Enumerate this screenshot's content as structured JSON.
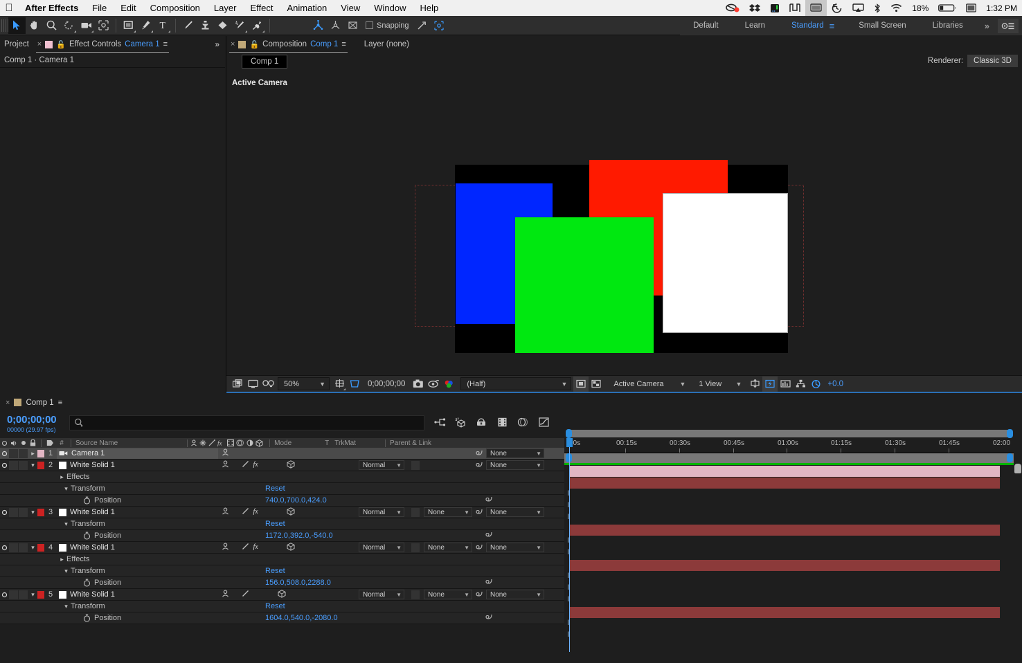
{
  "menubar": {
    "apple": "apple-logo",
    "app": "After Effects",
    "items": [
      "File",
      "Edit",
      "Composition",
      "Layer",
      "Effect",
      "Animation",
      "View",
      "Window",
      "Help"
    ],
    "status": {
      "battery_percent": "18%",
      "time": "1:32 PM",
      "icons": [
        "screen-record-icon",
        "dropbox-icon",
        "drive-icon",
        "sidecar-icon",
        "display-icon",
        "time-machine-icon",
        "airplay-icon",
        "bluetooth-icon",
        "wifi-icon",
        "battery-icon",
        "input-source-icon"
      ]
    }
  },
  "toolbar": {
    "tools": [
      {
        "name": "selection-tool",
        "glyph": "➤",
        "selected": true
      },
      {
        "name": "hand-tool",
        "glyph": "✋",
        "selected": false
      },
      {
        "name": "zoom-tool",
        "glyph": "🔍",
        "selected": false
      },
      {
        "name": "rotation-tool",
        "glyph": "↺",
        "selected": false
      },
      {
        "name": "camera-tool",
        "glyph": "🎥",
        "selected": false
      },
      {
        "name": "pan-behind-tool",
        "glyph": "⬚",
        "selected": false
      },
      {
        "name": "shape-tool",
        "glyph": "■",
        "selected": false
      },
      {
        "name": "pen-tool",
        "glyph": "✒",
        "selected": false
      },
      {
        "name": "text-tool",
        "glyph": "T",
        "selected": false
      },
      {
        "name": "brush-tool",
        "glyph": "╱",
        "selected": false
      },
      {
        "name": "clone-stamp-tool",
        "glyph": "⚒",
        "selected": false
      },
      {
        "name": "eraser-tool",
        "glyph": "◆",
        "selected": false
      },
      {
        "name": "roto-brush-tool",
        "glyph": "✦",
        "selected": false
      },
      {
        "name": "puppet-pin-tool",
        "glyph": "📌",
        "selected": false
      }
    ],
    "axis_modes": [
      {
        "name": "local-axis-mode",
        "selected": true
      },
      {
        "name": "world-axis-mode",
        "selected": false
      },
      {
        "name": "view-axis-mode",
        "selected": false
      }
    ],
    "snapping_label": "Snapping",
    "snapping_checked": false
  },
  "workspaces": {
    "items": [
      "Default",
      "Learn",
      "Standard",
      "Small Screen",
      "Libraries"
    ],
    "selected": "Standard",
    "overflow": "»",
    "gear_name": "workspace-settings-icon"
  },
  "left_panel": {
    "tabs": [
      {
        "label": "Project",
        "active": false,
        "closable": false
      },
      {
        "label": "Effect Controls",
        "target": "Camera 1",
        "active": true,
        "closable": true
      }
    ],
    "subheader": "Comp 1 · Camera 1"
  },
  "comp_panel": {
    "tabs": [
      {
        "label": "Composition",
        "target": "Comp 1",
        "active": true,
        "closable": true
      },
      {
        "label": "Layer (none)",
        "active": false,
        "closable": false
      }
    ],
    "comp_chip": "Comp 1",
    "renderer_label": "Renderer:",
    "renderer_value": "Classic 3D",
    "view_label": "Active Camera",
    "bottom_bar": {
      "magnification": "50%",
      "timecode": "0;00;00;00",
      "resolution": "(Half)",
      "view_select": "Active Camera",
      "view_layout": "1 View",
      "exposure": "+0.0",
      "icons": [
        "always-preview-icon",
        "main-viewer-icon",
        "3d-glasses-icon",
        "region-of-interest-icon",
        "transparency-grid-icon",
        "take-snapshot-icon",
        "show-snapshot-icon",
        "channel-icon",
        "mask-visibility-icon",
        "toggle-guides-icon",
        "3d-view-popup-icon",
        "pixel-aspect-icon",
        "fast-previews-icon",
        "timeline-icon",
        "comp-flowchart-icon",
        "exposure-icon"
      ]
    }
  },
  "timeline": {
    "tab_label": "Comp 1",
    "current_time": "0;00;00;00",
    "frame_info": "00000 (29.97 fps)",
    "search_placeholder": "",
    "columns": [
      "Source Name",
      "Mode",
      "T",
      "TrkMat",
      "Parent & Link"
    ],
    "header_icons": [
      "video-toggle-icon",
      "audio-toggle-icon",
      "solo-icon",
      "lock-icon",
      "label-icon",
      "index-icon"
    ],
    "switch_icons": [
      "shy-icon",
      "collapse-icon",
      "quality-icon",
      "effects-icon",
      "frame-blend-icon",
      "motion-blur-icon",
      "adjustment-icon",
      "3d-layer-icon"
    ],
    "panel_icons": [
      "composition-mini-flowchart-icon",
      "draft-3d-icon",
      "hide-shy-layers-icon",
      "enable-frame-blending-icon",
      "enable-motion-blur-icon",
      "graph-editor-icon"
    ],
    "ruler_ticks": [
      "00s",
      "00:15s",
      "00:30s",
      "00:45s",
      "01:00s",
      "01:15s",
      "01:30s",
      "01:45s",
      "02:00"
    ],
    "layers": [
      {
        "index": "1",
        "name": "Camera 1",
        "type": "camera",
        "label_color": "#e2b6c4",
        "selected": true,
        "expanded": false,
        "mode": null,
        "trkmat": null,
        "parent": "None",
        "bar_color": "#e2b6c4",
        "properties": []
      },
      {
        "index": "2",
        "name": "White Solid 1",
        "type": "solid",
        "label_color": "#cc2222",
        "selected": false,
        "expanded": true,
        "mode": "Normal",
        "trkmat": null,
        "parent": "None",
        "bar_color": "#8c3a3a",
        "properties": [
          {
            "name": "Effects",
            "kind": "group",
            "expanded": false,
            "value": null
          },
          {
            "name": "Transform",
            "kind": "group",
            "expanded": true,
            "value": "Reset"
          },
          {
            "name": "Position",
            "kind": "prop",
            "value": "740.0,700.0,424.0"
          }
        ]
      },
      {
        "index": "3",
        "name": "White Solid 1",
        "type": "solid",
        "label_color": "#cc2222",
        "selected": false,
        "expanded": true,
        "mode": "Normal",
        "trkmat": "None",
        "parent": "None",
        "bar_color": "#8c3a3a",
        "properties": [
          {
            "name": "Transform",
            "kind": "group",
            "expanded": true,
            "value": "Reset"
          },
          {
            "name": "Position",
            "kind": "prop",
            "value": "1172.0,392.0,-540.0"
          }
        ]
      },
      {
        "index": "4",
        "name": "White Solid 1",
        "type": "solid",
        "label_color": "#cc2222",
        "selected": false,
        "expanded": true,
        "mode": "Normal",
        "trkmat": "None",
        "parent": "None",
        "bar_color": "#8c3a3a",
        "properties": [
          {
            "name": "Effects",
            "kind": "group",
            "expanded": false,
            "value": null
          },
          {
            "name": "Transform",
            "kind": "group",
            "expanded": true,
            "value": "Reset"
          },
          {
            "name": "Position",
            "kind": "prop",
            "value": "156.0,508.0,2288.0"
          }
        ]
      },
      {
        "index": "5",
        "name": "White Solid 1",
        "type": "solid",
        "label_color": "#cc2222",
        "selected": false,
        "expanded": true,
        "mode": "Normal",
        "trkmat": "None",
        "parent": "None",
        "bar_color": "#8c3a3a",
        "properties": [
          {
            "name": "Transform",
            "kind": "group",
            "expanded": true,
            "value": "Reset"
          },
          {
            "name": "Position",
            "kind": "prop",
            "value": "1604.0,540.0,-2080.0"
          }
        ]
      }
    ]
  },
  "viewer_solids": [
    {
      "name": "blue-solid",
      "color": "#0026ff"
    },
    {
      "name": "red-solid",
      "color": "#ff1a00"
    },
    {
      "name": "green-solid",
      "color": "#00e810"
    },
    {
      "name": "white-solid",
      "color": "#ffffff"
    },
    {
      "name": "comp-background",
      "color": "#000000"
    }
  ],
  "accent": {
    "blue": "#4a9eff",
    "panel_bg": "#1e1e1e",
    "row_bg": "#252525",
    "selected_row": "#4a4a4a"
  }
}
